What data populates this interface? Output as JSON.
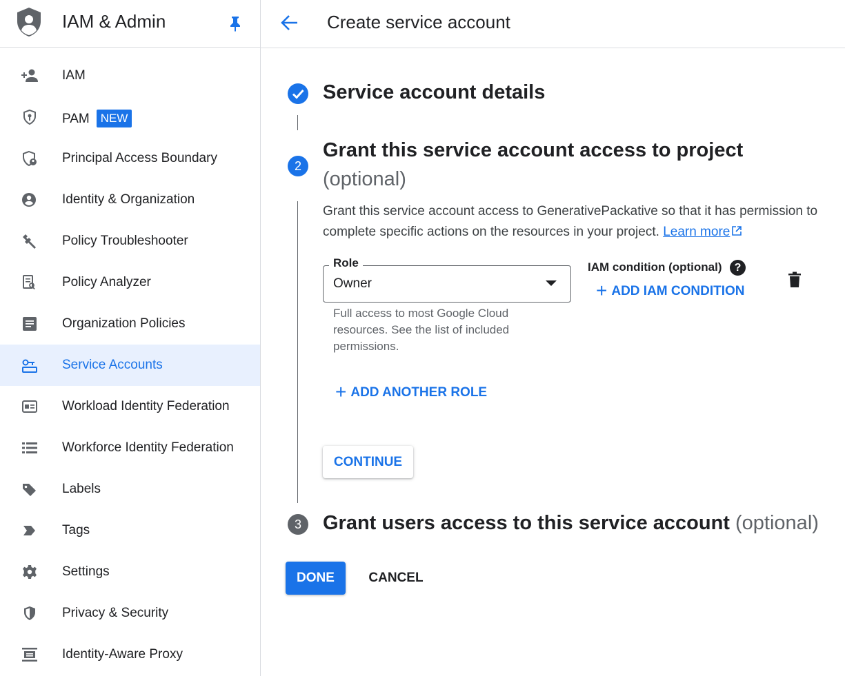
{
  "sidebar": {
    "title": "IAM & Admin",
    "items": [
      {
        "label": "IAM",
        "icon": "person-add-icon"
      },
      {
        "label": "PAM",
        "icon": "shield-key-icon",
        "badge": "NEW"
      },
      {
        "label": "Principal Access Boundary",
        "icon": "shield-person-icon"
      },
      {
        "label": "Identity & Organization",
        "icon": "account-circle-icon"
      },
      {
        "label": "Policy Troubleshooter",
        "icon": "wrench-icon"
      },
      {
        "label": "Policy Analyzer",
        "icon": "document-search-icon"
      },
      {
        "label": "Organization Policies",
        "icon": "article-icon"
      },
      {
        "label": "Service Accounts",
        "icon": "service-account-icon",
        "active": true
      },
      {
        "label": "Workload Identity Federation",
        "icon": "id-card-icon"
      },
      {
        "label": "Workforce Identity Federation",
        "icon": "list-icon"
      },
      {
        "label": "Labels",
        "icon": "label-icon"
      },
      {
        "label": "Tags",
        "icon": "tag-arrow-icon"
      },
      {
        "label": "Settings",
        "icon": "gear-icon"
      },
      {
        "label": "Privacy & Security",
        "icon": "shield-icon"
      },
      {
        "label": "Identity-Aware Proxy",
        "icon": "proxy-icon"
      }
    ]
  },
  "header": {
    "title": "Create service account"
  },
  "steps": {
    "step1": {
      "title": "Service account details"
    },
    "step2": {
      "number": "2",
      "title": "Grant this service account access to project",
      "optional": "(optional)",
      "description": "Grant this service account access to GenerativePackative so that it has permission to complete specific actions on the resources in your project.",
      "learn_more": "Learn more"
    },
    "step3": {
      "number": "3",
      "title": "Grant users access to this service account",
      "optional": "(optional)"
    }
  },
  "role": {
    "label": "Role",
    "value": "Owner",
    "help": "Full access to most Google Cloud resources. See the list of included permissions."
  },
  "iam_condition": {
    "label": "IAM condition (optional)",
    "help_glyph": "?",
    "add_label": "ADD IAM CONDITION"
  },
  "add_role_label": "ADD ANOTHER ROLE",
  "continue_label": "CONTINUE",
  "done_label": "DONE",
  "cancel_label": "CANCEL",
  "colors": {
    "accent": "#1a73e8",
    "active_bg": "#e8f0fe",
    "text": "#202124",
    "muted": "#5f6368",
    "divider": "#dadce0"
  }
}
